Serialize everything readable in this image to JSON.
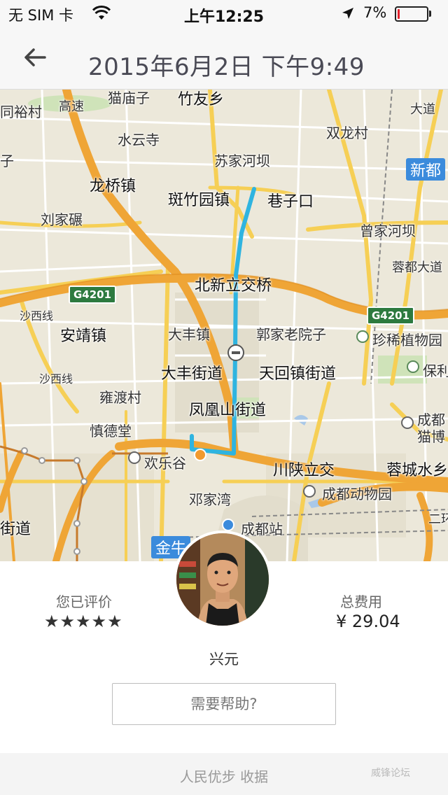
{
  "status_bar": {
    "carrier": "无 SIM 卡",
    "time": "上午12:25",
    "battery_percent": "7%",
    "battery_level": 0.07
  },
  "nav": {
    "title": "2015年6月2日 下午9:49",
    "back_icon": "arrow-left-icon"
  },
  "map": {
    "labels": [
      "猫庙子",
      "竹友乡",
      "同裕村",
      "高速",
      "水云寺",
      "双龙村",
      "大道",
      "苏家河坝",
      "新都",
      "子",
      "龙桥镇",
      "斑竹园镇",
      "巷子口",
      "刘家碾",
      "曾家河坝",
      "蓉都大道",
      "北新立交桥",
      "安靖镇",
      "大丰镇",
      "郭家老院子",
      "珍稀植物园",
      "沙西线",
      "大丰街道",
      "天回镇街道",
      "保利",
      "雍渡村",
      "凤凰山街道",
      "沙西线",
      "慎德堂",
      "成都",
      "猫博",
      "欢乐谷",
      "川陕立交",
      "蓉城水乡",
      "邓家湾",
      "成都动物园",
      "街道",
      "成都站",
      "二环路",
      "金牛"
    ],
    "road_badges": [
      "G4201",
      "G4201"
    ],
    "route_color": "#2fb4e0"
  },
  "trip": {
    "rating_label": "您已评价",
    "stars": "★★★★★",
    "rating": 5,
    "fare_label": "总费用",
    "fare_value": "¥ 29.04",
    "driver_name": "兴元",
    "help_button": "需要帮助?"
  },
  "footer": {
    "receipt_link": "人民优步 收据",
    "watermark": "威锋论坛"
  }
}
